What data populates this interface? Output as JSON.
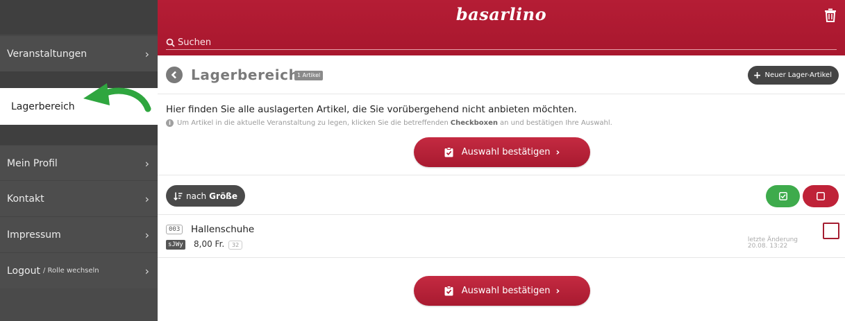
{
  "sidebar": {
    "items": [
      {
        "label": "Veranstaltungen"
      },
      {
        "label": "Lagerbereich"
      },
      {
        "label": "Mein Profil"
      },
      {
        "label": "Kontakt"
      },
      {
        "label": "Impressum"
      },
      {
        "label": "Logout",
        "sublabel": "/ Rolle wechseln"
      }
    ],
    "chevron": "›"
  },
  "header": {
    "logo": "basarlino",
    "search_placeholder": "Suchen"
  },
  "titlebar": {
    "title": "Lagerbereich",
    "count_badge": "1 Artikel",
    "new_button": "Neuer Lager-Artikel"
  },
  "info": {
    "main": "Hier finden Sie alle auslagerten Artikel, die Sie vorübergehend nicht anbieten möchten.",
    "sub_before": "Um Artikel in die aktuelle Veranstaltung zu legen, klicken Sie die betreffenden",
    "sub_bold": "Checkboxen",
    "sub_after": "an und bestätigen Ihre Auswahl."
  },
  "confirm_button": "Auswahl bestätigen",
  "sort": {
    "label": "nach",
    "value": "Größe"
  },
  "items": [
    {
      "number": "003",
      "name": "Hallenschuhe",
      "code": "sJWy",
      "price": "8,00 Fr.",
      "size": "32",
      "lastmod_label": "letzte Änderung",
      "lastmod_date": "20.08. 13:22"
    }
  ],
  "colors": {
    "brand": "#b01c33",
    "sidebar": "#4d4d4d",
    "select_all": "#3eab4c"
  }
}
